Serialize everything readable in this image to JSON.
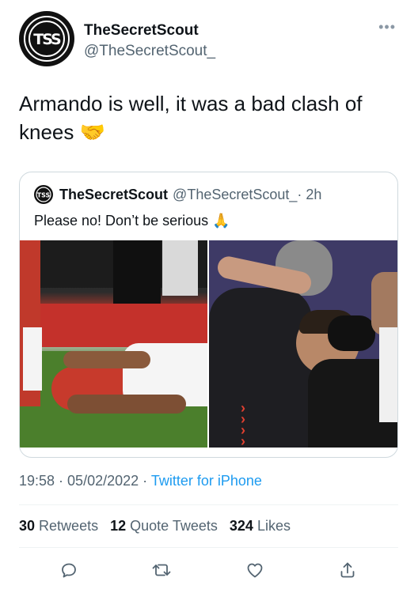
{
  "author": {
    "display_name": "TheSecretScout",
    "handle": "@TheSecretScout_",
    "avatar_text": "TSS"
  },
  "more_icon": "more-dots-icon",
  "tweet": {
    "text": "Armando is well, it was a bad clash of knees 🤝"
  },
  "quoted_tweet": {
    "display_name": "TheSecretScout",
    "handle": "@TheSecretScout_",
    "time": " · 2h",
    "text": "Please no! Don’t be serious 🙏",
    "photos": [
      "player-down-on-pitch",
      "player-consoled-by-staff"
    ]
  },
  "meta": {
    "time": "19:58",
    "separator1": " · ",
    "date": "05/02/2022",
    "separator2": " · ",
    "source": "Twitter for iPhone"
  },
  "stats": {
    "retweets_count": "30",
    "retweets_label": "Retweets",
    "quotes_count": "12",
    "quotes_label": "Quote Tweets",
    "likes_count": "324",
    "likes_label": "Likes"
  },
  "actions": [
    "reply-icon",
    "retweet-icon",
    "like-icon",
    "share-icon"
  ]
}
